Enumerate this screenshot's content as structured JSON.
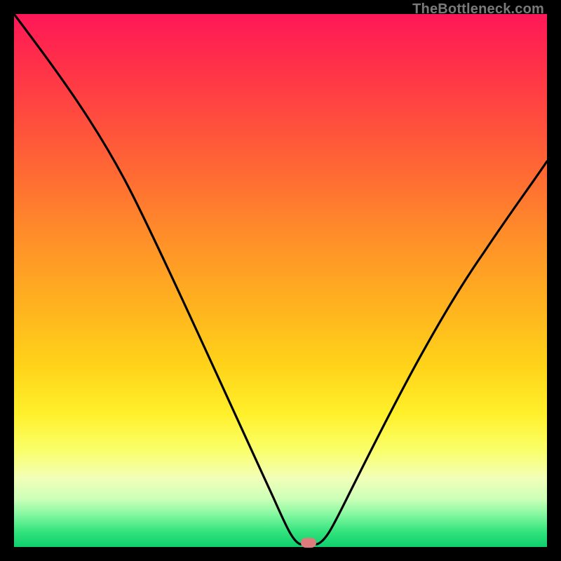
{
  "watermark": "TheBottleneck.com",
  "chart_data": {
    "type": "line",
    "title": "",
    "xlabel": "",
    "ylabel": "",
    "xlim": [
      0,
      100
    ],
    "ylim": [
      0,
      100
    ],
    "grid": false,
    "legend": false,
    "background_gradient": {
      "direction": "vertical",
      "stops": [
        {
          "pos": 0,
          "color": "#ff1858"
        },
        {
          "pos": 18,
          "color": "#ff4840"
        },
        {
          "pos": 42,
          "color": "#ff8f29"
        },
        {
          "pos": 66,
          "color": "#ffd319"
        },
        {
          "pos": 82,
          "color": "#f2ffb8"
        },
        {
          "pos": 97,
          "color": "#35e47e"
        },
        {
          "pos": 100,
          "color": "#0ecf6c"
        }
      ]
    },
    "series": [
      {
        "name": "bottleneck-curve",
        "x": [
          0,
          5,
          10,
          15,
          20,
          25,
          30,
          35,
          40,
          45,
          50,
          52,
          55,
          58,
          60,
          63,
          66,
          70,
          75,
          80,
          85,
          90,
          95,
          100
        ],
        "y": [
          100,
          92,
          83,
          74,
          64,
          54,
          44,
          35,
          26,
          18,
          10,
          6,
          1,
          0,
          2,
          8,
          16,
          27,
          38,
          49,
          57,
          64,
          69,
          73
        ]
      }
    ],
    "marker": {
      "x": 56.5,
      "y": 0,
      "shape": "pill",
      "color": "#de7b7d"
    },
    "annotations": []
  }
}
